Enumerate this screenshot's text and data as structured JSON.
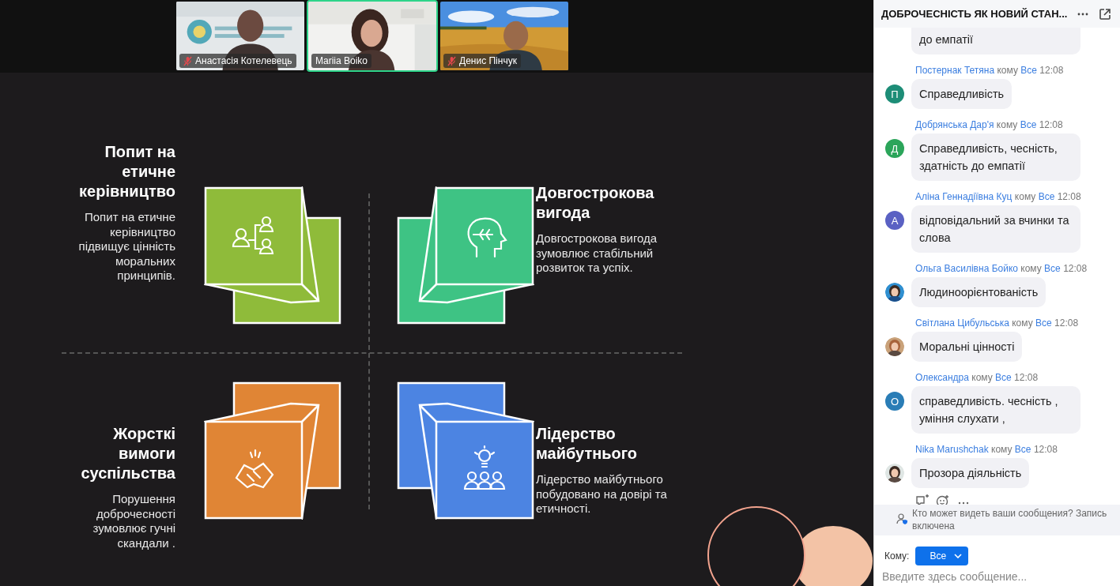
{
  "video_tiles": [
    {
      "name": "Анастасія Котелевець",
      "muted": true,
      "active": false
    },
    {
      "name": "Mariia Boiko",
      "muted": false,
      "active": true
    },
    {
      "name": "Денис Пінчук",
      "muted": true,
      "active": false
    }
  ],
  "slide": {
    "quadrants": [
      {
        "heading": "Попит на етичне керівництво",
        "body": "Попит на етичне керівництво підвищує цінність моральних принципів.",
        "color": "#8fbb3a"
      },
      {
        "heading": "Довгострокова вигода",
        "body": "Довгострокова вигода зумовлює стабільний розвиток та успіх.",
        "color": "#3ec384"
      },
      {
        "heading": "Жорсткі вимоги суспільства",
        "body": "Порушення доброчесності зумовлює гучні скандали .",
        "color": "#e08535"
      },
      {
        "heading": "Лідерство майбутнього",
        "body": "Лідерство майбутнього побудовано на довірі та етичності.",
        "color": "#4c84e2"
      }
    ]
  },
  "chat": {
    "title": "ДОБРОЧЕСНІСТЬ ЯК НОВИЙ СТАН...",
    "cut_bubble": "до емпатії",
    "messages": [
      {
        "sender": "Постернак Тетяна",
        "to_word": "кому",
        "recipient": "Все",
        "time": "12:08",
        "avatar": {
          "kind": "letter",
          "letter": "П",
          "color": "#1d8d77"
        },
        "text": "Справедливість"
      },
      {
        "sender": "Добрянська Дар'я",
        "to_word": "кому",
        "recipient": "Все",
        "time": "12:08",
        "avatar": {
          "kind": "letter",
          "letter": "Д",
          "color": "#2ba55a"
        },
        "text": "Справедливість, чесність, здатність до емпатії"
      },
      {
        "sender": "Аліна Геннадіївна Куц",
        "to_word": "кому",
        "recipient": "Все",
        "time": "12:08",
        "avatar": {
          "kind": "letter",
          "letter": "А",
          "color": "#5a61c3"
        },
        "text": "відповідальний за вчинки та слова"
      },
      {
        "sender": "Ольга Василівна Бойко",
        "to_word": "кому",
        "recipient": "Все",
        "time": "12:08",
        "text": "Людиноорієнтованість"
      },
      {
        "sender": "Світлана Цибульська",
        "to_word": "кому",
        "recipient": "Все",
        "time": "12:08",
        "text": "Моральні цінності"
      },
      {
        "sender": "Олександра",
        "to_word": "кому",
        "recipient": "Все",
        "time": "12:08",
        "avatar": {
          "kind": "letter",
          "letter": "О",
          "color": "#2a7db6"
        },
        "text": "справедливість. чесність , уміння слухати ,"
      },
      {
        "sender": "Nika Marushchak",
        "to_word": "кому",
        "recipient": "Все",
        "time": "12:08",
        "text": "Прозора діяльність"
      }
    ],
    "notice": "Кто может видеть ваши сообщения? Запись включена",
    "to_label": "Кому:",
    "to_value": "Все",
    "input": {
      "placeholder": "Введите здесь сообщение..."
    }
  }
}
